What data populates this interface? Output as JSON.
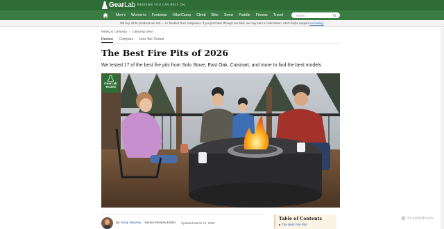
{
  "brand": {
    "logo_gear": "Gear",
    "logo_lab": "Lab",
    "tagline": "REVIEWS YOU CAN RELY ON",
    "color_dark_green": "#2f6d37",
    "color_nav_green": "#3a7c42",
    "link_color": "#2a62b8"
  },
  "nav": {
    "home_icon": "home-icon",
    "items": [
      "Men's",
      "Women's",
      "Footwear",
      "Hike/Camp",
      "Climb",
      "Bike",
      "Snow",
      "Paddle",
      "Fitness",
      "Travel"
    ],
    "search_placeholder": "Search..."
  },
  "disclosure": {
    "text": "We buy all the products we test — no freebies from companies. If you purchase through our links, we may earn a commission, which helps support ",
    "link": "our testing."
  },
  "breadcrumb": {
    "items": [
      "Hiking & Camping",
      "Camping Gear"
    ],
    "separator": "›"
  },
  "tabs": {
    "items": [
      "Review",
      "Compare",
      "How We Tested"
    ],
    "active": "Review"
  },
  "article": {
    "title": "The Best Fire Pits of 2026",
    "subtitle": "We tested 17 of the best fire pits from Solo Stove, East Oak, Cuisinart, and more to find the best models"
  },
  "badge": {
    "line1": "GearLab",
    "line2": "Tested"
  },
  "byline": {
    "by": "By",
    "author": "Kenji Mowrey",
    "role": "Senior Review Editor",
    "updated": "Updated March 10, 2026"
  },
  "toc": {
    "title": "Table of Contents",
    "items": [
      "The Best Fire Pits"
    ]
  },
  "watermark": {
    "text": "ScanMalware"
  }
}
